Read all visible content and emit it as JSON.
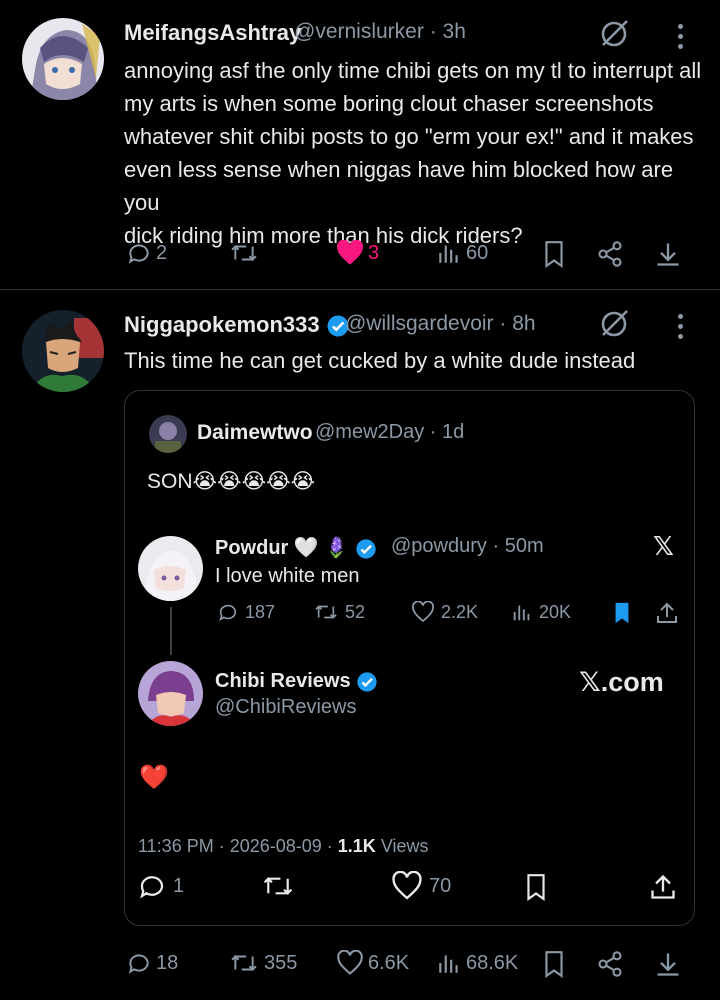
{
  "tweet1": {
    "name": "MeifangsAshtray",
    "handle": "@vernislurker",
    "time": "3h",
    "text_lines": [
      "annoying asf the only time chibi gets on my tl to interrupt all",
      "my arts is when some boring clout chaser screenshots",
      "whatever shit chibi posts to go \"erm your ex!\" and it makes",
      "even less sense when niggas have him blocked how are you",
      "dick riding him more than his dick riders?"
    ],
    "replies": "2",
    "retweets": "",
    "likes": "3",
    "views": "60"
  },
  "tweet2": {
    "name": "Niggapokemon333",
    "handle": "@willsgardevoir",
    "time": "8h",
    "text": "This time he can get cucked by a white dude instead",
    "replies": "18",
    "retweets": "355",
    "likes": "6.6K",
    "views": "68.6K",
    "quote": {
      "name": "Daimewtwo",
      "handle": "@mew2Day",
      "time": "1d",
      "text": "SON😭😭😭😭😭",
      "embed": {
        "reply": {
          "name": "Powdur",
          "name_emojis": "🤍 🪻",
          "handle": "@powdury",
          "time": "50m",
          "text": "I love white men",
          "replies": "187",
          "retweets": "52",
          "likes": "2.2K",
          "views": "20K"
        },
        "main": {
          "name": "Chibi Reviews",
          "handle": "@ChibiReviews",
          "text": "❤️",
          "timestamp": "11:36 PM · 2026-08-09 · ",
          "views_count": "1.1K",
          "views_label": " Views",
          "replies": "1",
          "retweets": "",
          "likes": "70",
          "brand": "𝕏.com"
        }
      }
    }
  },
  "colors": {
    "background": "#000000",
    "text": "#e7e9ea",
    "muted": "#8b98a5",
    "like": "#f91880",
    "verified": "#1d9bf0"
  },
  "icons": [
    "reply-icon",
    "retweet-icon",
    "heart-icon",
    "views-icon",
    "bookmark-icon",
    "share-icon",
    "download-icon",
    "grok-icon",
    "more-icon",
    "verified-icon",
    "x-logo-icon"
  ]
}
